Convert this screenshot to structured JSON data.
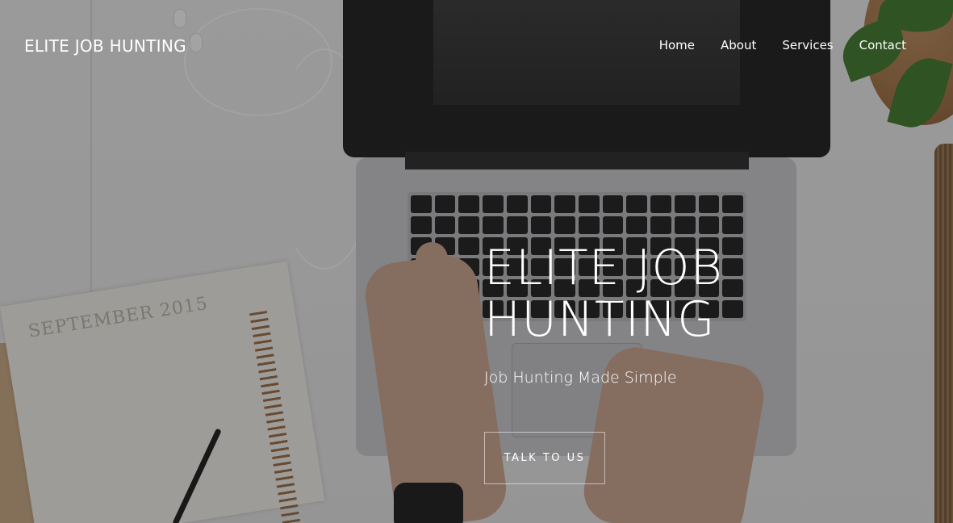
{
  "header": {
    "brand": "ELITE JOB HUNTING",
    "nav": [
      {
        "label": "Home"
      },
      {
        "label": "About"
      },
      {
        "label": "Services"
      },
      {
        "label": "Contact"
      }
    ]
  },
  "hero": {
    "title_line1": "ELITE JOB",
    "title_line2": "HUNTING",
    "subtitle": "Job Hunting Made Simple",
    "cta_label": "TALK TO US",
    "background": {
      "calendar_title": "SEPTEMBER 2015"
    }
  },
  "colors": {
    "text": "#ffffff",
    "overlay": "rgba(20,20,22,0.38)"
  }
}
